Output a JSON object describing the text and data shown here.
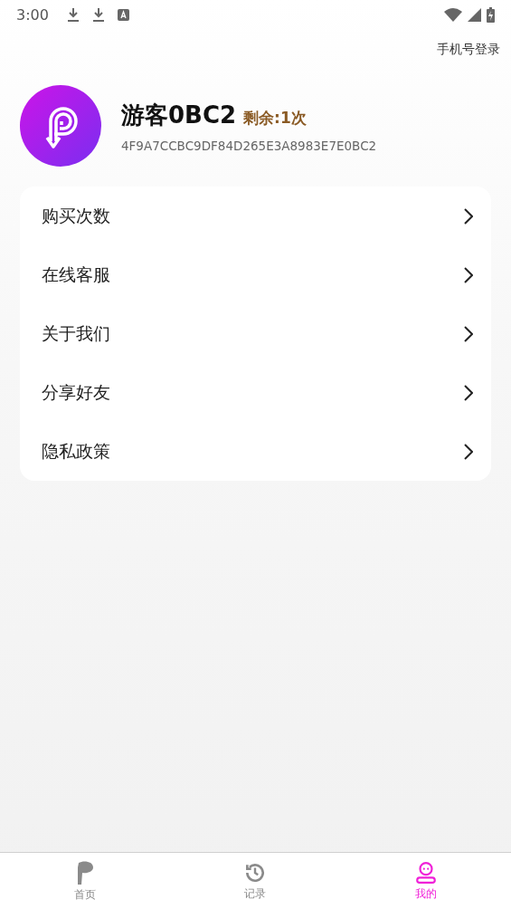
{
  "status_bar": {
    "time": "3:00"
  },
  "login_link": "手机号登录",
  "profile": {
    "name": "游客0BC2",
    "remaining": "剩余:1次",
    "device_id": "4F9A7CCBC9DF84D265E3A8983E7E0BC2"
  },
  "menu": [
    {
      "label": "购买次数"
    },
    {
      "label": "在线客服"
    },
    {
      "label": "关于我们"
    },
    {
      "label": "分享好友"
    },
    {
      "label": "隐私政策"
    }
  ],
  "tabs": [
    {
      "label": "首页",
      "kind": "home",
      "selected": false
    },
    {
      "label": "记录",
      "kind": "history",
      "selected": false
    },
    {
      "label": "我的",
      "kind": "profile",
      "selected": true
    }
  ]
}
